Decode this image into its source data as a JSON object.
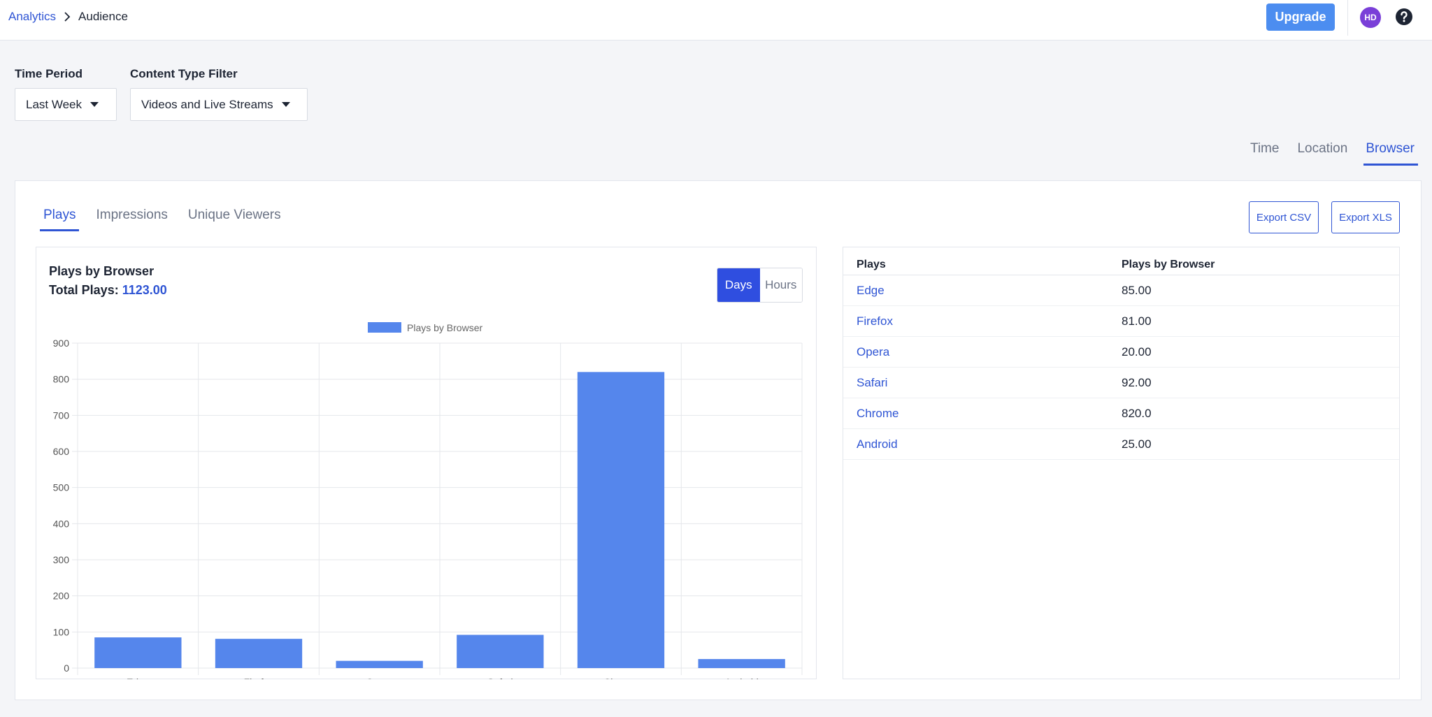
{
  "breadcrumb": {
    "parent": "Analytics",
    "current": "Audience"
  },
  "header": {
    "upgrade_label": "Upgrade",
    "avatar_initials": "HD"
  },
  "filters": {
    "time_period": {
      "label": "Time Period",
      "value": "Last Week"
    },
    "content_type": {
      "label": "Content Type Filter",
      "value": "Videos and Live Streams"
    }
  },
  "view_tabs": [
    {
      "label": "Time",
      "active": false
    },
    {
      "label": "Location",
      "active": false
    },
    {
      "label": "Browser",
      "active": true
    }
  ],
  "metric_tabs": [
    {
      "label": "Plays",
      "active": true
    },
    {
      "label": "Impressions",
      "active": false
    },
    {
      "label": "Unique Viewers",
      "active": false
    }
  ],
  "export": {
    "csv_label": "Export CSV",
    "xls_label": "Export XLS"
  },
  "chart_panel": {
    "title": "Plays by Browser",
    "total_label": "Total Plays:",
    "total_value": "1123.00",
    "toggle": {
      "days": "Days",
      "hours": "Hours",
      "active": "days"
    }
  },
  "chart_data": {
    "type": "bar",
    "categories": [
      "Edge",
      "Firefox",
      "Opera",
      "Safari",
      "Chrome",
      "Android"
    ],
    "series": [
      {
        "name": "Plays by Browser",
        "values": [
          85,
          81,
          20,
          92,
          820,
          25
        ],
        "color": "#5586ec"
      }
    ],
    "y_ticks": [
      "0",
      "100",
      "200",
      "300",
      "400",
      "500",
      "600",
      "700",
      "800",
      "900"
    ],
    "ylim": [
      0,
      900
    ],
    "grid": true,
    "legend": "top-center"
  },
  "table": {
    "headers": [
      "Plays",
      "Plays by Browser"
    ],
    "rows": [
      {
        "name": "Edge",
        "value": "85.00"
      },
      {
        "name": "Firefox",
        "value": "81.00"
      },
      {
        "name": "Opera",
        "value": "20.00"
      },
      {
        "name": "Safari",
        "value": "92.00"
      },
      {
        "name": "Chrome",
        "value": "820.0"
      },
      {
        "name": "Android",
        "value": "25.00"
      }
    ]
  },
  "colors": {
    "accent": "#2f55d4",
    "upgrade": "#4c8df0",
    "avatar": "#7a3fd8",
    "bar": "#5586ec"
  }
}
